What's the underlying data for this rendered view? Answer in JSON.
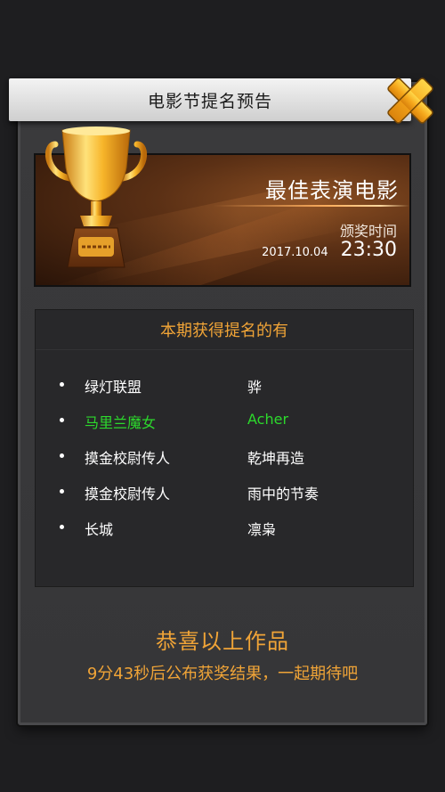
{
  "modal": {
    "title": "电影节提名预告",
    "close_icon": "close-x-icon"
  },
  "banner": {
    "trophy_icon": "gold-trophy-icon",
    "award_name": "最佳表演电影",
    "time_label": "颁奖时间",
    "date": "2017.10.04",
    "time": "23:30"
  },
  "nominations": {
    "heading": "本期获得提名的有",
    "items": [
      {
        "work": "绿灯联盟",
        "person": "骅",
        "highlighted": false
      },
      {
        "work": "马里兰魔女",
        "person": "Acher",
        "highlighted": true
      },
      {
        "work": "摸金校尉传人",
        "person": "乾坤再造",
        "highlighted": false
      },
      {
        "work": "摸金校尉传人",
        "person": "雨中的节奏",
        "highlighted": false
      },
      {
        "work": "长城",
        "person": "凛枭",
        "highlighted": false
      }
    ]
  },
  "footer": {
    "congrats": "恭喜以上作品",
    "countdown": "9分43秒后公布获奖结果，一起期待吧"
  },
  "colors": {
    "accent": "#f0a437",
    "highlight": "#2cd92c",
    "panel_bg": "#28282a",
    "modal_bg": "#3a3a3c"
  }
}
